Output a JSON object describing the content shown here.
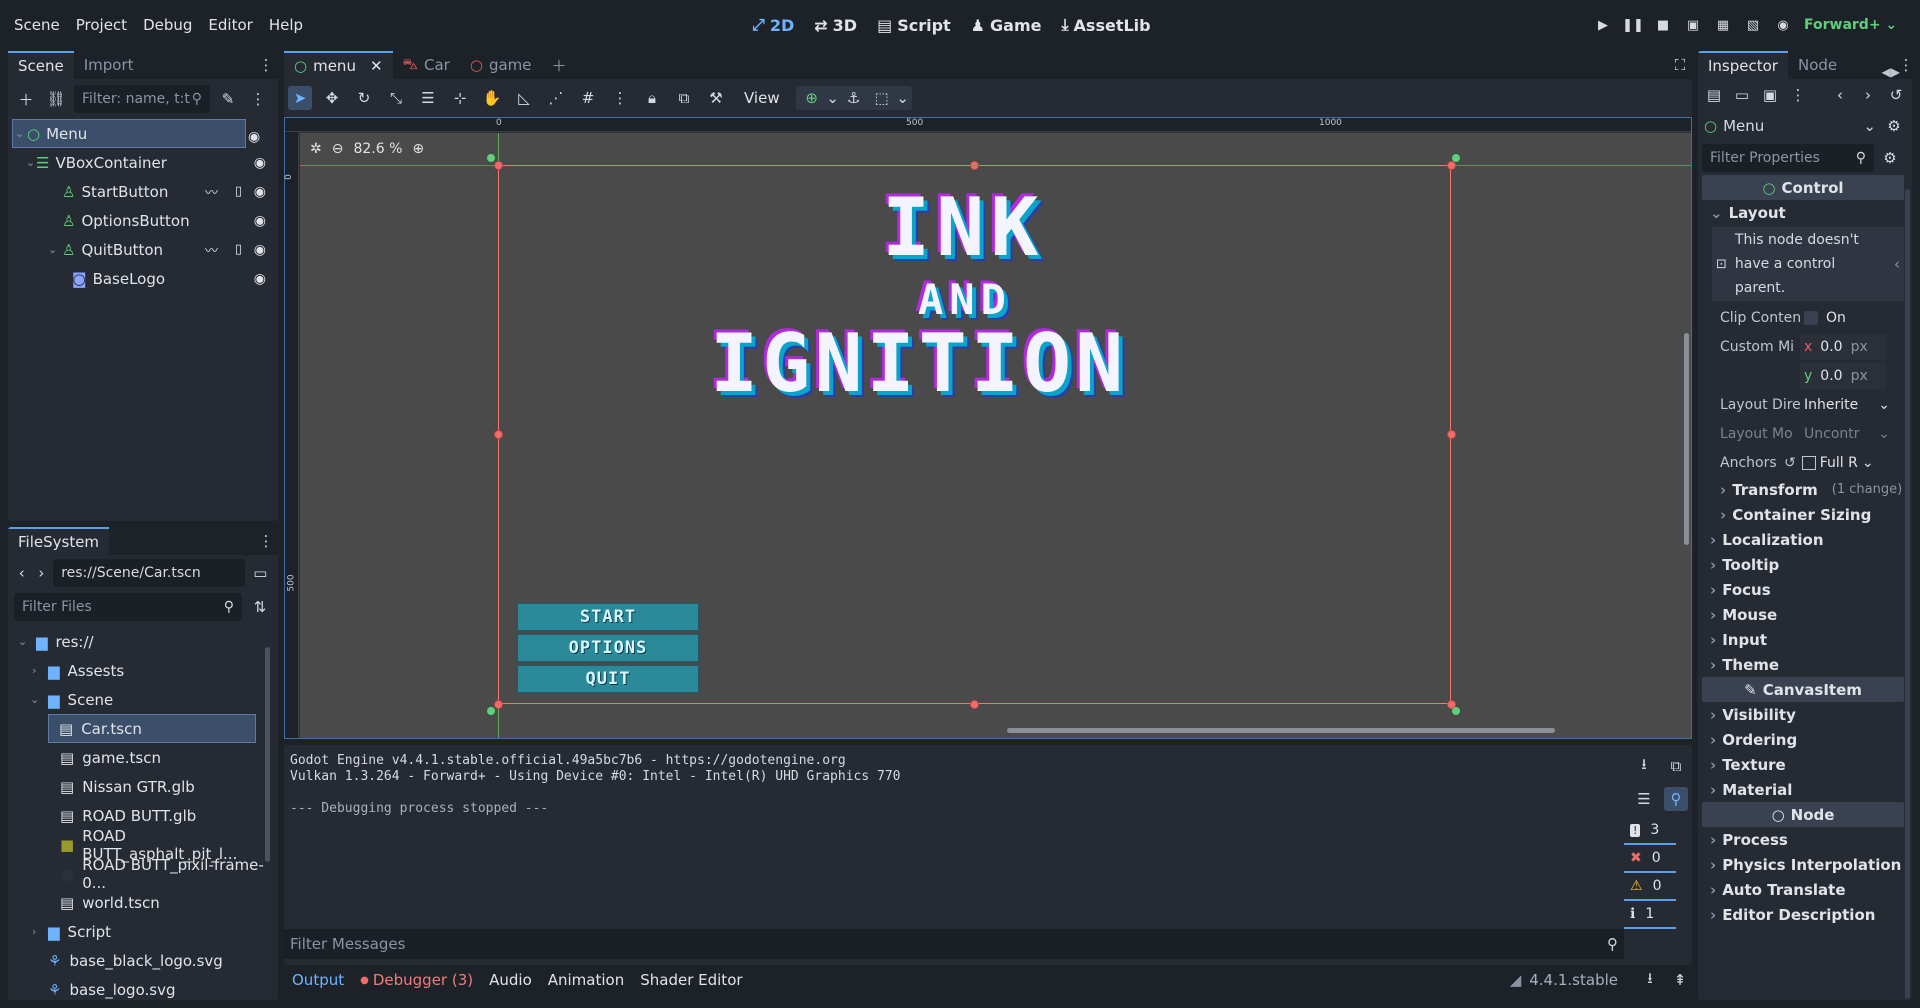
{
  "menu": [
    "Scene",
    "Project",
    "Debug",
    "Editor",
    "Help"
  ],
  "workspaces": [
    {
      "label": "2D",
      "icon": "2d-icon",
      "active": true
    },
    {
      "label": "3D",
      "icon": "3d-icon",
      "active": false
    },
    {
      "label": "Script",
      "icon": "script-icon",
      "active": false
    },
    {
      "label": "Game",
      "icon": "game-icon",
      "active": false
    },
    {
      "label": "AssetLib",
      "icon": "assetlib-icon",
      "active": false
    }
  ],
  "renderer": "Forward+",
  "scene_dock": {
    "tabs": [
      "Scene",
      "Import"
    ],
    "filter_placeholder": "Filter: name, t:t",
    "tree": [
      {
        "name": "Menu",
        "depth": 0,
        "type": "control"
      },
      {
        "name": "VBoxContainer",
        "depth": 1,
        "type": "vbox"
      },
      {
        "name": "StartButton",
        "depth": 2,
        "type": "button"
      },
      {
        "name": "OptionsButton",
        "depth": 2,
        "type": "button"
      },
      {
        "name": "QuitButton",
        "depth": 2,
        "type": "button"
      },
      {
        "name": "BaseLogo",
        "depth": 3,
        "type": "sprite"
      }
    ]
  },
  "filesystem": {
    "title": "FileSystem",
    "path": "res://Scene/Car.tscn",
    "filter_placeholder": "Filter Files",
    "items": [
      {
        "name": "res://",
        "depth": 0,
        "kind": "folder"
      },
      {
        "name": "Assests",
        "depth": 1,
        "kind": "folder"
      },
      {
        "name": "Scene",
        "depth": 1,
        "kind": "folder"
      },
      {
        "name": "Car.tscn",
        "depth": 2,
        "kind": "scene"
      },
      {
        "name": "game.tscn",
        "depth": 2,
        "kind": "scene"
      },
      {
        "name": "Nissan GTR.glb",
        "depth": 2,
        "kind": "scene"
      },
      {
        "name": "ROAD BUTT.glb",
        "depth": 2,
        "kind": "scene"
      },
      {
        "name": "ROAD BUTT_asphalt_pit_l...",
        "depth": 2,
        "kind": "image"
      },
      {
        "name": "ROAD BUTT_pixil-frame-0...",
        "depth": 2,
        "kind": "image-dark"
      },
      {
        "name": "world.tscn",
        "depth": 2,
        "kind": "scene"
      },
      {
        "name": "Script",
        "depth": 1,
        "kind": "folder"
      },
      {
        "name": "base_black_logo.svg",
        "depth": 1,
        "kind": "svg"
      },
      {
        "name": "base_logo.svg",
        "depth": 1,
        "kind": "svg"
      }
    ]
  },
  "editor_tabs": [
    {
      "label": "menu",
      "active": true
    },
    {
      "label": "Car",
      "active": false
    },
    {
      "label": "game",
      "active": false
    }
  ],
  "toolbar": {
    "view_label": "View"
  },
  "viewport": {
    "zoom": "82.6 %",
    "ruler_marks": [
      "0",
      "500",
      "1000"
    ],
    "ruler_v_marks": [
      "0",
      "500"
    ],
    "logo_line1": "INK",
    "logo_line2": "AND",
    "logo_line3": "IGNITION",
    "buttons": [
      "START",
      "OPTIONS",
      "QUIT"
    ]
  },
  "output": {
    "lines": [
      "Godot Engine v4.4.1.stable.official.49a5bc7b6 - https://godotengine.org",
      "Vulkan 1.3.264 - Forward+ - Using Device #0: Intel - Intel(R) UHD Graphics 770",
      "",
      "--- Debugging process stopped ---"
    ],
    "filter_placeholder": "Filter Messages",
    "counts": [
      "3",
      "0",
      "0",
      "1"
    ],
    "tabs": [
      "Output",
      "Debugger (3)",
      "Audio",
      "Animation",
      "Shader Editor"
    ],
    "version": "4.4.1.stable"
  },
  "inspector": {
    "tabs": [
      "Inspector",
      "Node"
    ],
    "node_name": "Menu",
    "filter_placeholder": "Filter Properties",
    "control_header": "Control",
    "layout_label": "Layout",
    "warning": [
      "This node doesn't",
      "have a control",
      "parent."
    ],
    "props": {
      "clip_label": "Clip Conten",
      "clip_value": "On",
      "custom_min_label": "Custom Mi",
      "x_val": "0.0",
      "y_val": "0.0",
      "unit": "px",
      "x_axis": "x",
      "y_axis": "y",
      "layout_dir_label": "Layout Dire",
      "layout_dir_value": "Inherite",
      "layout_mode_label": "Layout Mo",
      "layout_mode_value": "Uncontr",
      "anchors_label": "Anchors",
      "anchors_value": "Full R"
    },
    "transform_label": "Transform",
    "transform_change": "(1 change)",
    "container_sizing": "Container Sizing",
    "categories1": [
      "Localization",
      "Tooltip",
      "Focus",
      "Mouse",
      "Input",
      "Theme"
    ],
    "canvas_header": "CanvasItem",
    "categories2": [
      "Visibility",
      "Ordering",
      "Texture",
      "Material"
    ],
    "node_header": "Node",
    "categories3": [
      "Process",
      "Physics Interpolation",
      "Auto Translate",
      "Editor Description"
    ]
  },
  "colors": {
    "accent": "#6fb3ff",
    "selection": "#3b4f6b",
    "canvas": "#4a4a4a",
    "button_fill": "#2a8a9a",
    "guide": "#f26b6b",
    "success": "#5fd07a"
  }
}
